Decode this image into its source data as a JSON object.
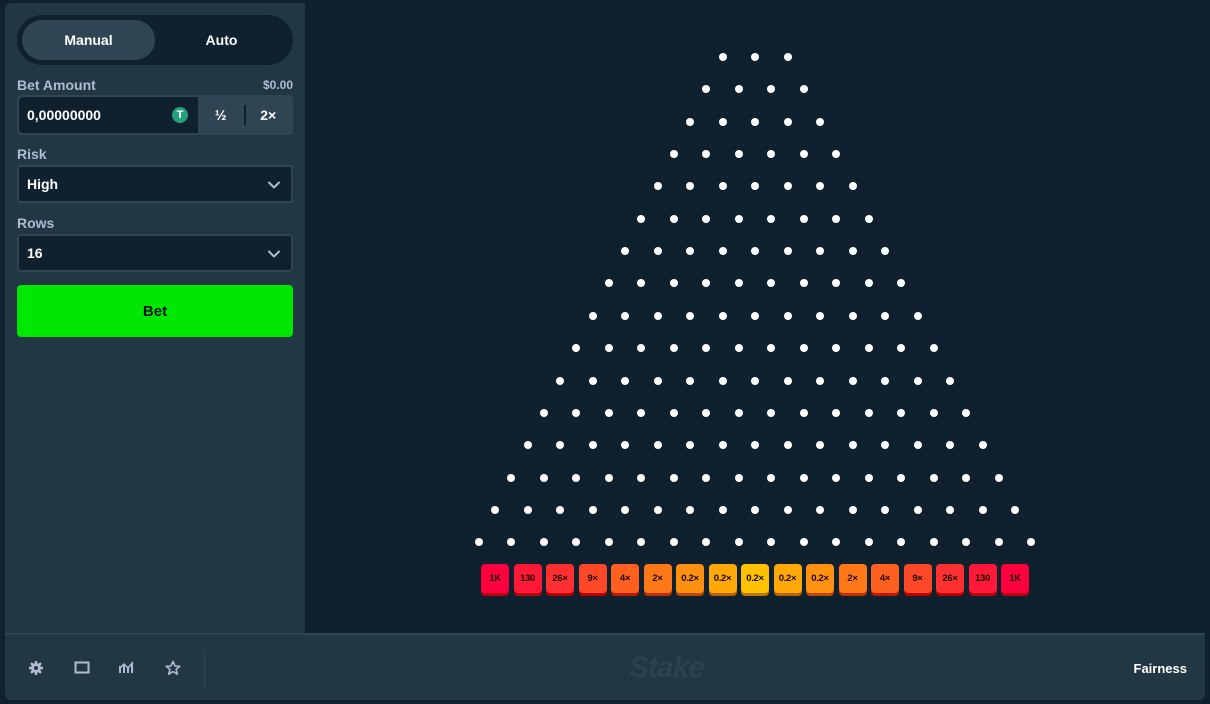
{
  "sidebar": {
    "tabs": [
      {
        "label": "Manual",
        "active": true
      },
      {
        "label": "Auto",
        "active": false
      }
    ],
    "bet_amount_label": "Bet Amount",
    "bet_amount_usd": "$0.00",
    "bet_amount_value": "0,00000000",
    "currency_icon": "tether-icon",
    "half_label": "½",
    "double_label": "2×",
    "risk_label": "Risk",
    "risk_value": "High",
    "rows_label": "Rows",
    "rows_value": "16",
    "bet_button_label": "Bet"
  },
  "game": {
    "rows": 16,
    "multipliers": [
      "1K",
      "130",
      "26×",
      "9×",
      "4×",
      "2×",
      "0.2×",
      "0.2×",
      "0.2×",
      "0.2×",
      "0.2×",
      "2×",
      "4×",
      "9×",
      "26×",
      "130",
      "1K"
    ],
    "bucket_colors": [
      "#ff003f",
      "#ff1837",
      "#ff302f",
      "#ff4827",
      "#ff6020",
      "#ff7818",
      "#ff9010",
      "#ffa808",
      "#ffc000",
      "#ffa808",
      "#ff9010",
      "#ff7818",
      "#ff6020",
      "#ff4827",
      "#ff302f",
      "#ff1837",
      "#ff003f"
    ]
  },
  "footer": {
    "icons": [
      "settings-icon",
      "theatre-mode-icon",
      "live-stats-icon",
      "favourite-icon"
    ],
    "logo_text": "Stake",
    "fairness_label": "Fairness"
  },
  "colors": {
    "accent_green": "#00e701",
    "panel": "#213743",
    "background": "#0f212e"
  }
}
